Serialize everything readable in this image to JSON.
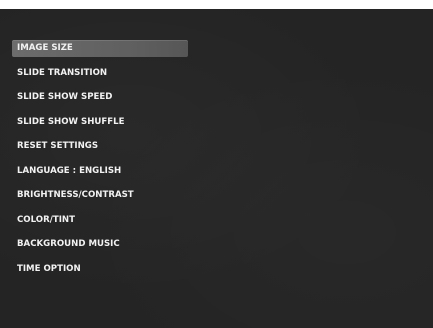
{
  "menu": {
    "items": [
      {
        "label": "IMAGE SIZE",
        "selected": true
      },
      {
        "label": "SLIDE TRANSITION"
      },
      {
        "label": "SLIDE SHOW SPEED"
      },
      {
        "label": "SLIDE SHOW SHUFFLE"
      },
      {
        "label": "RESET SETTINGS"
      },
      {
        "label": "LANGUAGE : ENGLISH"
      },
      {
        "label": "BRIGHTNESS/CONTRAST"
      },
      {
        "label": "COLOR/TINT"
      },
      {
        "label": "BACKGROUND MUSIC"
      },
      {
        "label": "TIME OPTION"
      }
    ]
  },
  "colors": {
    "screen_background": "#242424",
    "highlight": "#666666",
    "text": "#f2f2f2"
  }
}
